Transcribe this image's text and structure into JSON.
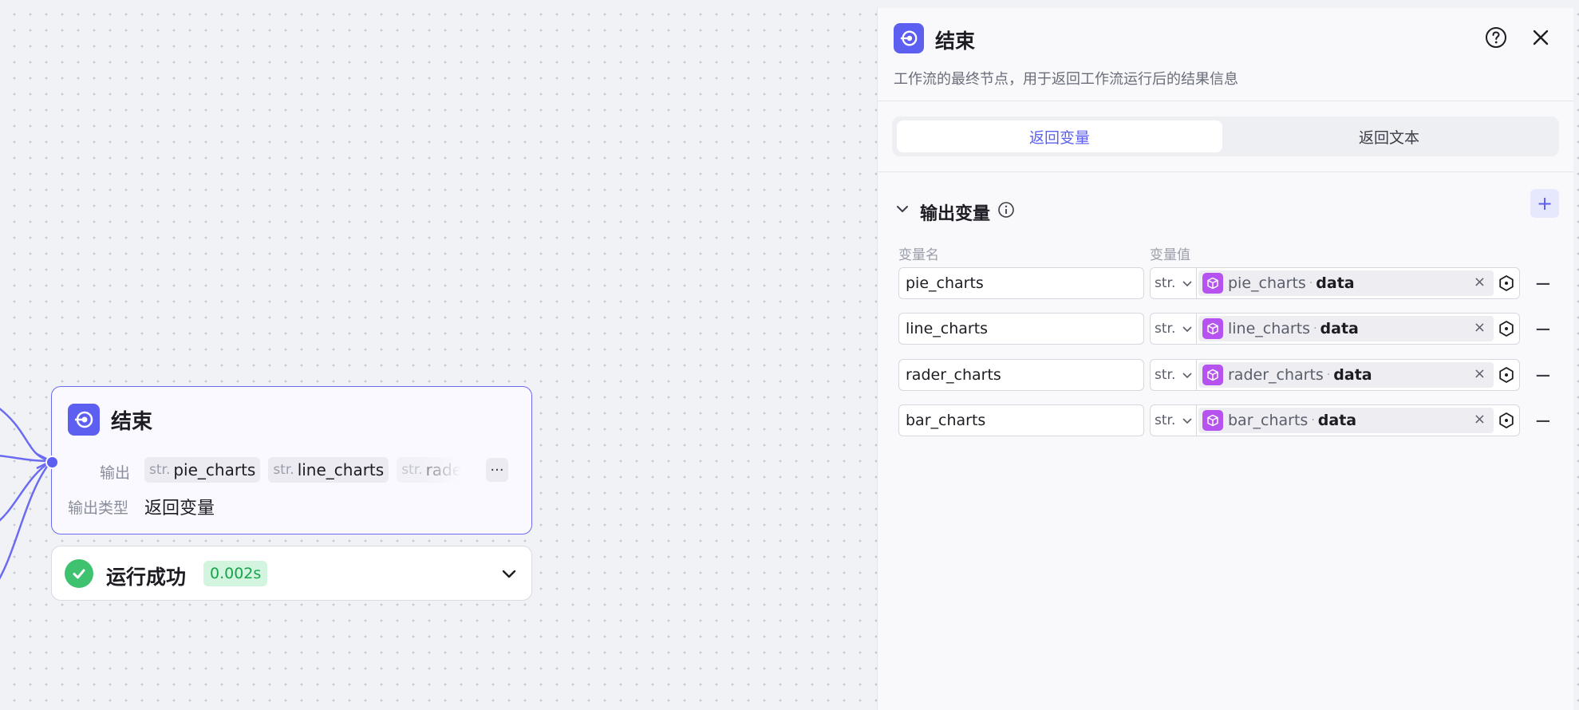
{
  "node": {
    "title": "结束",
    "output_label": "输出",
    "output_tags": [
      {
        "type": "str.",
        "name": "pie_charts"
      },
      {
        "type": "str.",
        "name": "line_charts"
      },
      {
        "type": "str.",
        "name": "rader"
      }
    ],
    "more_label": "···",
    "type_label": "输出类型",
    "type_value": "返回变量",
    "icon": "end-node-icon"
  },
  "run_status": {
    "text": "运行成功",
    "time": "0.002s",
    "success_color": "#3ec26f"
  },
  "panel": {
    "title": "结束",
    "description": "工作流的最终节点，用于返回工作流运行后的结果信息",
    "tabs": [
      {
        "label": "返回变量",
        "active": true
      },
      {
        "label": "返回文本",
        "active": false
      }
    ],
    "section_title": "输出变量",
    "col_name": "变量名",
    "col_value": "变量值",
    "rows": [
      {
        "name": "pie_charts",
        "type": "str.",
        "ref_node": "pie_charts",
        "ref_field": "data"
      },
      {
        "name": "line_charts",
        "type": "str.",
        "ref_node": "line_charts",
        "ref_field": "data"
      },
      {
        "name": "rader_charts",
        "type": "str.",
        "ref_node": "rader_charts",
        "ref_field": "data"
      },
      {
        "name": "bar_charts",
        "type": "str.",
        "ref_node": "bar_charts",
        "ref_field": "data"
      }
    ],
    "sep": "·",
    "clear_glyph": "×",
    "remove_glyph": "−",
    "add_glyph": "+"
  },
  "colors": {
    "accent": "#5c5ff0",
    "chip_icon": "#b552f0",
    "time_badge_bg": "#d3f4de",
    "time_badge_text": "#16a34a"
  }
}
